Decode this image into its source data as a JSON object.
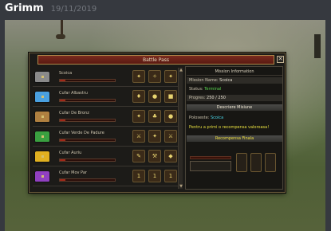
{
  "message": {
    "author": "Grimm",
    "timestamp": "19/11/2019"
  },
  "window": {
    "title": "Battle Pass",
    "close_icon": "close-icon"
  },
  "missions": [
    {
      "name": "Scoica",
      "chest_color": "#8a8a8a",
      "progress": 0.1
    },
    {
      "name": "Cufar Albastru",
      "chest_color": "#4aa0e0",
      "progress": 0.1
    },
    {
      "name": "Cufar De Bronz",
      "chest_color": "#b08040",
      "progress": 0.1
    },
    {
      "name": "Cufar Verde De Padure",
      "chest_color": "#3aa040",
      "progress": 0.1
    },
    {
      "name": "Cufar Auriu",
      "chest_color": "#e0b020",
      "progress": 0.1
    },
    {
      "name": "Cufar Mov Par",
      "chest_color": "#9040c0",
      "progress": 0.1
    }
  ],
  "reward_counts": {
    "row0": [
      "",
      "",
      ""
    ],
    "row5": [
      "1",
      "1",
      "1"
    ]
  },
  "info": {
    "header": "Mission Information",
    "mission_name_label": "Mission Name:",
    "mission_name_value": "Scoica",
    "status_label": "Status:",
    "status_value": "Terminal",
    "progress_label": "Progres:",
    "progress_value": "250 / 250",
    "description_header": "Descriere Misiune",
    "poloseste_label": "Poloseste:",
    "poloseste_value": "Scoica",
    "reward_text": "Pentru a primi o recompensa valoroasa!",
    "final_reward_header": "Recompensa Finala"
  }
}
